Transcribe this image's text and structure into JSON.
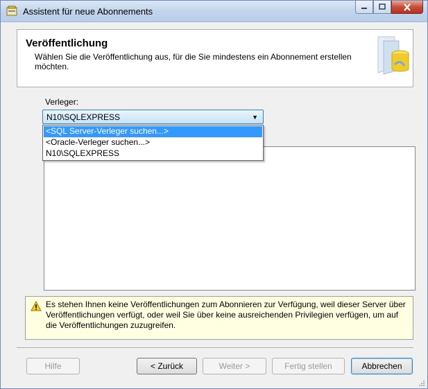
{
  "window": {
    "title": "Assistent für neue Abonnements"
  },
  "header": {
    "title": "Veröffentlichung",
    "subtitle": "Wählen Sie die Veröffentlichung aus, für die Sie mindestens ein Abonnement erstellen möchten."
  },
  "publisher": {
    "label": "Verleger:",
    "selected": "N10\\SQLEXPRESS",
    "options": [
      "<SQL Server-Verleger suchen...>",
      "<Oracle-Verleger suchen...>",
      "N10\\SQLEXPRESS"
    ],
    "highlighted_index": 0
  },
  "warning": {
    "text": "Es stehen Ihnen keine Veröffentlichungen zum Abonnieren zur Verfügung, weil dieser Server über Veröffentlichungen verfügt, oder weil Sie über keine ausreichenden Privilegien verfügen, um auf die Veröffentlichungen zuzugreifen."
  },
  "buttons": {
    "help": "Hilfe",
    "back": "< Zurück",
    "next": "Weiter >",
    "finish": "Fertig stellen",
    "cancel": "Abbrechen"
  },
  "icons": {
    "app": "wizard-app-icon",
    "header": "database-publication-icon",
    "warning": "warning-icon"
  }
}
